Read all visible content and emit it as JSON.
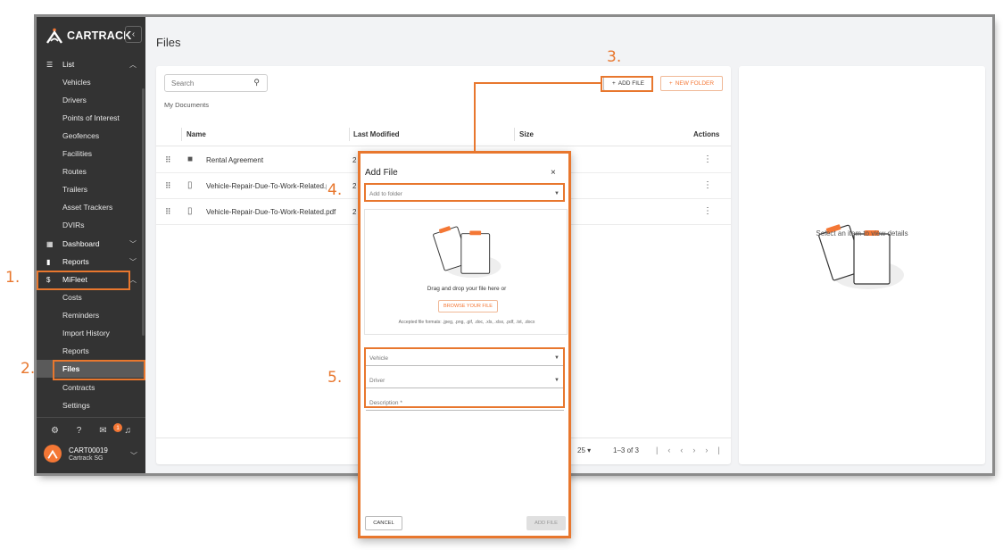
{
  "brand": {
    "name": "CARTRACK",
    "accent": "#f47735",
    "annotation_color": "#e8772e"
  },
  "sidebar": {
    "collapse_icon": "chevron-left-icon",
    "sections": [
      {
        "label": "List",
        "icon": "list-icon"
      },
      {
        "label": "Dashboard",
        "icon": "dashboard-icon"
      },
      {
        "label": "Reports",
        "icon": "bar-chart-icon"
      },
      {
        "label": "MiFleet",
        "icon": "dollar-icon"
      }
    ],
    "list_items": [
      "Vehicles",
      "Drivers",
      "Points of Interest",
      "Geofences",
      "Facilities",
      "Routes",
      "Trailers",
      "Asset Trackers",
      "DVIRs"
    ],
    "mifleet_items": [
      "Costs",
      "Reminders",
      "Import History",
      "Reports",
      "Files",
      "Contracts",
      "Settings"
    ],
    "footer_icons": [
      "settings-icon",
      "help-icon",
      "notifications-icon",
      "bell-icon"
    ],
    "notification_count": "1",
    "user": {
      "name": "CART00019",
      "subtitle": "Cartrack SG"
    }
  },
  "page": {
    "title": "Files"
  },
  "files": {
    "search_placeholder": "Search",
    "breadcrumb": "My Documents",
    "add_file_label": "ADD FILE",
    "new_folder_label": "NEW FOLDER",
    "columns": [
      "Name",
      "Last Modified",
      "Size",
      "Actions"
    ],
    "rows": [
      {
        "name": "Rental Agreement",
        "modified": "2",
        "type": "folder"
      },
      {
        "name": "Vehicle-Repair-Due-To-Work-Related.p",
        "modified": "2",
        "type": "file"
      },
      {
        "name": "Vehicle-Repair-Due-To-Work-Related.pdf",
        "modified": "2",
        "type": "file"
      }
    ],
    "rows_per_page": "25",
    "page_info": "1–3 of 3"
  },
  "details": {
    "empty_text": "Select an item to view details"
  },
  "dialog": {
    "title": "Add File",
    "folder_placeholder": "Add to folder",
    "drop_text": "Drag and drop your file here or",
    "browse_label": "BROWSE YOUR FILE",
    "formats": "Accepted file formats: .jpeg, .png, .gif, .doc, .xls, .xlsx, .pdf, .txt, .docx",
    "vehicle_placeholder": "Vehicle",
    "driver_placeholder": "Driver",
    "description_placeholder": "Description *",
    "cancel_label": "CANCEL",
    "submit_label": "ADD FILE"
  },
  "annotations": [
    "1.",
    "2.",
    "3.",
    "4.",
    "5."
  ]
}
